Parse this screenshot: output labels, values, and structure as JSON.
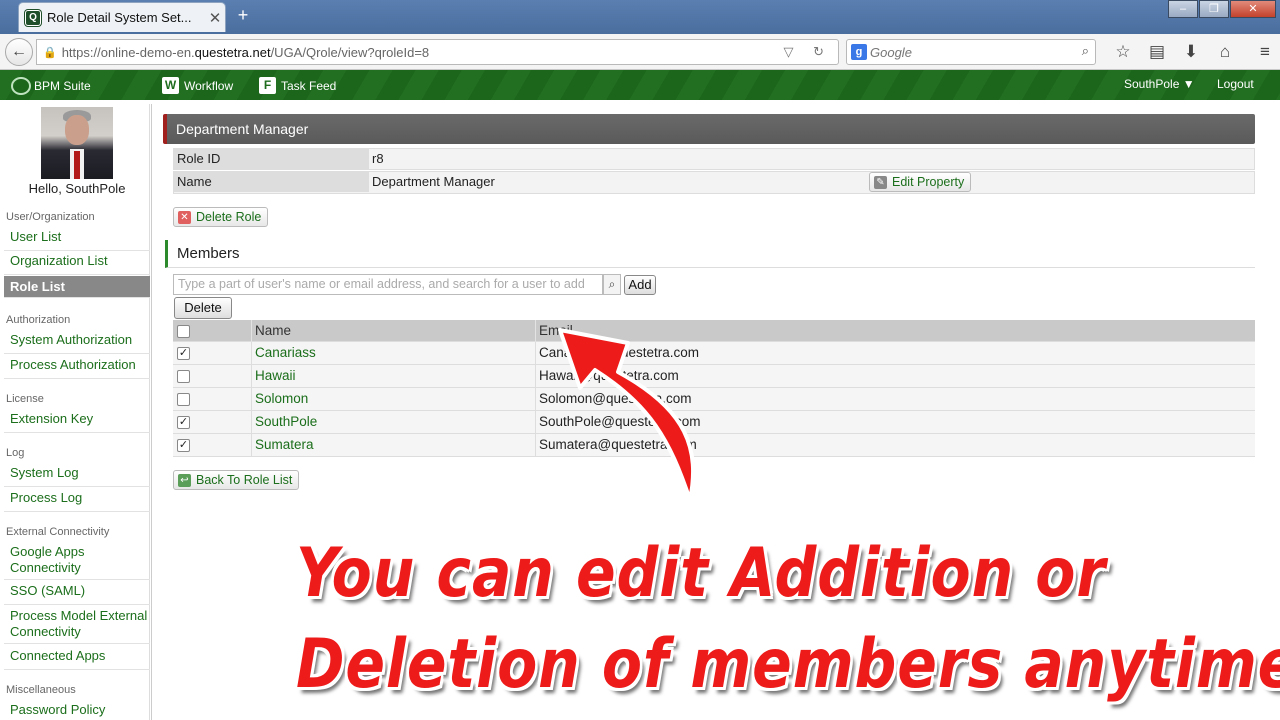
{
  "browser": {
    "tab_title": "Role Detail System Set...",
    "new_tab": "+",
    "url_prefix": "https://online-demo-en.",
    "url_domain": "questetra.net",
    "url_path": "/UGA/Qrole/view?qroleId=8",
    "search_engine_placeholder": "Google"
  },
  "app": {
    "logo_text": "BPM Suite",
    "nav": {
      "workflow": "Workflow",
      "task_feed": "Task Feed"
    },
    "user_menu": "SouthPole ▼",
    "logout": "Logout"
  },
  "sidebar": {
    "greeting": "Hello, SouthPole",
    "sections": {
      "user_org": "User/Organization",
      "authorization": "Authorization",
      "license": "License",
      "log": "Log",
      "external": "External Connectivity",
      "misc": "Miscellaneous"
    },
    "links": {
      "user_list": "User List",
      "organization_list": "Organization List",
      "role_list": "Role List",
      "system_authorization": "System Authorization",
      "process_authorization": "Process Authorization",
      "extension_key": "Extension Key",
      "system_log": "System Log",
      "process_log": "Process Log",
      "google_apps_1": "Google Apps",
      "google_apps_2": "Connectivity",
      "sso": "SSO (SAML)",
      "process_model_1": "Process Model External",
      "process_model_2": "Connectivity",
      "connected_apps": "Connected Apps",
      "password_policy": "Password Policy"
    }
  },
  "role": {
    "title": "Department Manager",
    "id_label": "Role ID",
    "id_value": "r8",
    "name_label": "Name",
    "name_value": "Department Manager",
    "edit_property": "Edit Property",
    "delete_role": "Delete Role"
  },
  "members": {
    "heading": "Members",
    "search_placeholder": "Type a part of user's name or email address, and search for a user to add",
    "add_label": "Add",
    "delete_label": "Delete",
    "columns": {
      "name": "Name",
      "email": "Email"
    },
    "rows": [
      {
        "name": "Canariass",
        "email": "Canariass@questetra.com",
        "checked": true
      },
      {
        "name": "Hawaii",
        "email": "Hawaii@questetra.com",
        "checked": false
      },
      {
        "name": "Solomon",
        "email": "Solomon@questetra.com",
        "checked": false
      },
      {
        "name": "SouthPole",
        "email": "SouthPole@questetra.com",
        "checked": true
      },
      {
        "name": "Sumatera",
        "email": "Sumatera@questetra.com",
        "checked": true
      }
    ],
    "back_label": "Back To Role List"
  },
  "annotation": {
    "line1": "You can edit Addition or",
    "line2": "Deletion of members anytime",
    "color": "#ee1b1b"
  }
}
